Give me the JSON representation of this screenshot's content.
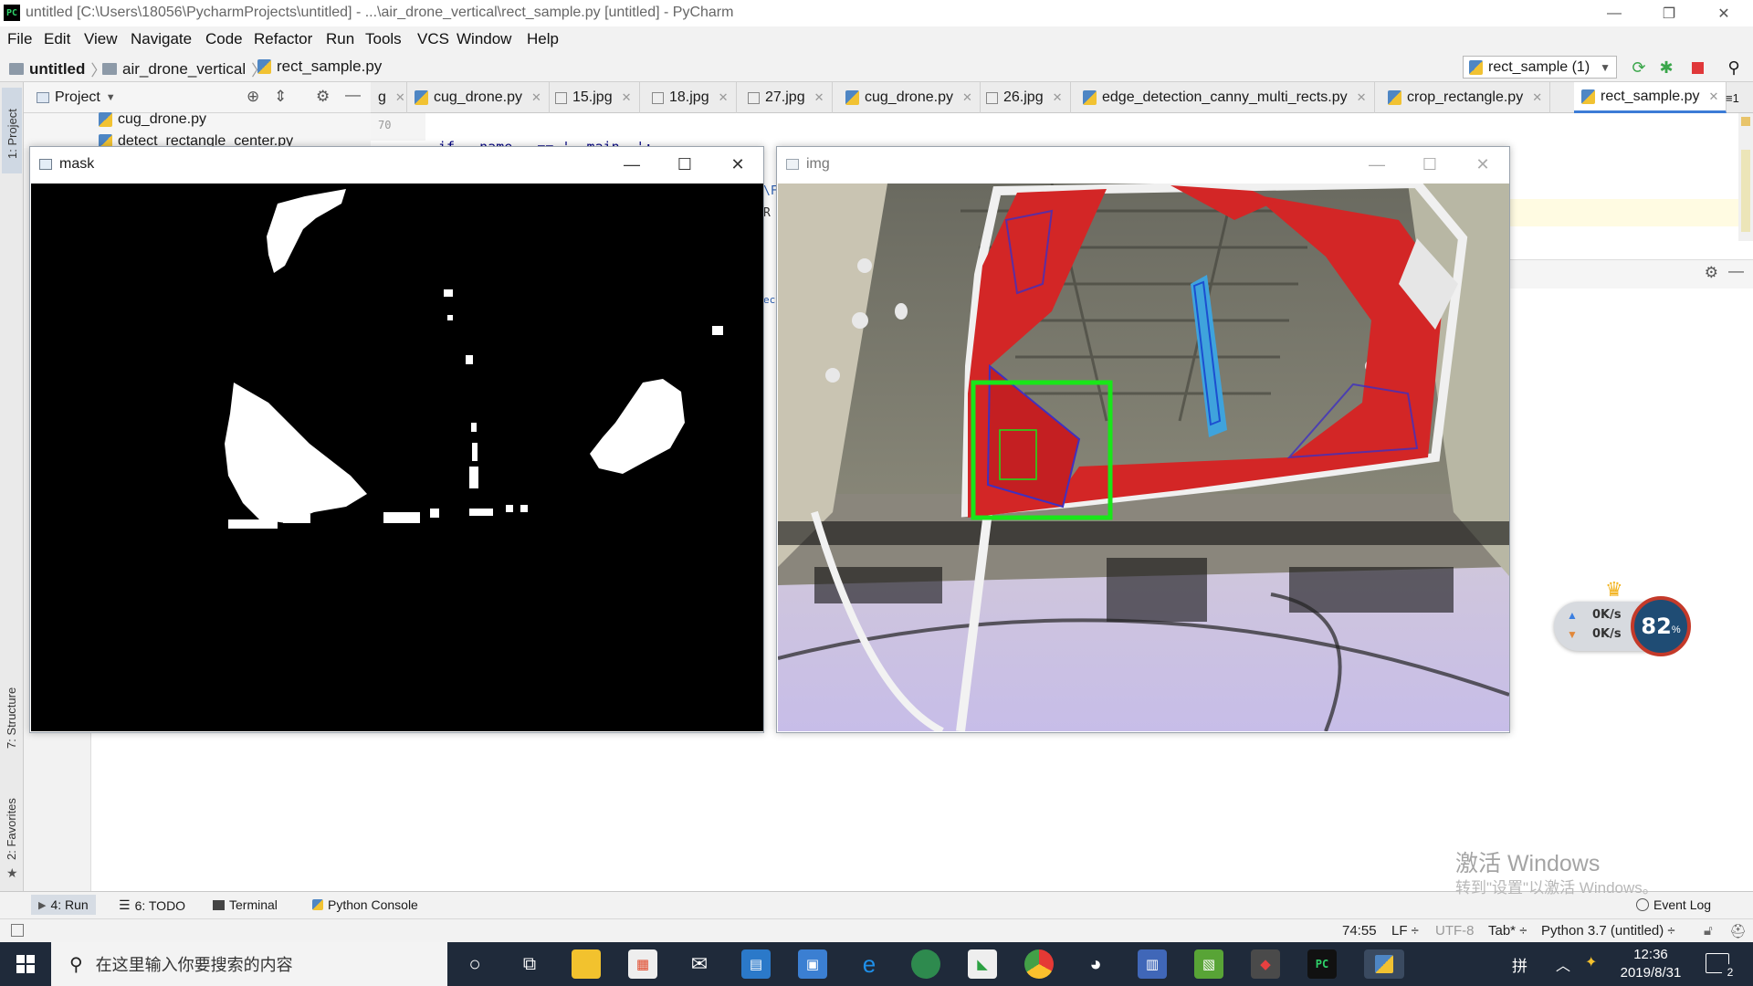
{
  "window": {
    "title": "untitled [C:\\Users\\18056\\PycharmProjects\\untitled] - ...\\air_drone_vertical\\rect_sample.py [untitled] - PyCharm",
    "app_icon": "PC"
  },
  "menu": [
    "File",
    "Edit",
    "View",
    "Navigate",
    "Code",
    "Refactor",
    "Run",
    "Tools",
    "VCS",
    "Window",
    "Help"
  ],
  "breadcrumb": {
    "project": "untitled",
    "folder": "air_drone_vertical",
    "file": "rect_sample.py"
  },
  "run_config": {
    "label": "rect_sample (1)"
  },
  "left_tools": {
    "project": "1: Project",
    "structure": "7: Structure",
    "favorites": "2: Favorites"
  },
  "project_panel": {
    "title": "Project",
    "files": [
      "cug_drone.py",
      "detect_rectangle_center.py"
    ]
  },
  "tabs": [
    {
      "label": "g",
      "type": "image"
    },
    {
      "label": "cug_drone.py",
      "type": "py"
    },
    {
      "label": "15.jpg",
      "type": "image"
    },
    {
      "label": "18.jpg",
      "type": "image"
    },
    {
      "label": "27.jpg",
      "type": "image"
    },
    {
      "label": "cug_drone.py",
      "type": "py"
    },
    {
      "label": "26.jpg",
      "type": "image"
    },
    {
      "label": "edge_detection_canny_multi_rects.py",
      "type": "py"
    },
    {
      "label": "crop_rectangle.py",
      "type": "py"
    },
    {
      "label": "rect_sample.py",
      "type": "py",
      "active": true
    }
  ],
  "tab_overflow": "≡1",
  "editor": {
    "line_number": "70",
    "code_snippet": "if __name__ == '__main__':",
    "peek_chars": [
      "\\F",
      "R",
      "ec"
    ]
  },
  "cv_windows": {
    "mask": {
      "title": "mask"
    },
    "img": {
      "title": "img"
    }
  },
  "bottom_tools": {
    "run": "4: Run",
    "todo": "6: TODO",
    "terminal": "Terminal",
    "python_console": "Python Console",
    "event_log": "Event Log"
  },
  "status": {
    "position": "74:55",
    "line_sep": "LF ÷",
    "encoding": "UTF-8",
    "indent": "Tab* ÷",
    "interpreter": "Python 3.7 (untitled) ÷"
  },
  "watermark": {
    "line1": "激活 Windows",
    "line2": "转到\"设置\"以激活 Windows。"
  },
  "net_widget": {
    "up": "0K/s",
    "down": "0K/s",
    "percent": "82",
    "percent_sign": "%"
  },
  "taskbar": {
    "search_placeholder": "在这里输入你要搜索的内容",
    "ime": "拼",
    "time": "12:36",
    "date": "2019/8/31",
    "notifications": "2"
  },
  "colors": {
    "accent": "#3c7cd6",
    "red_region": "#d32626",
    "green_box": "#19e619",
    "taskbar": "#1f2a3a"
  }
}
